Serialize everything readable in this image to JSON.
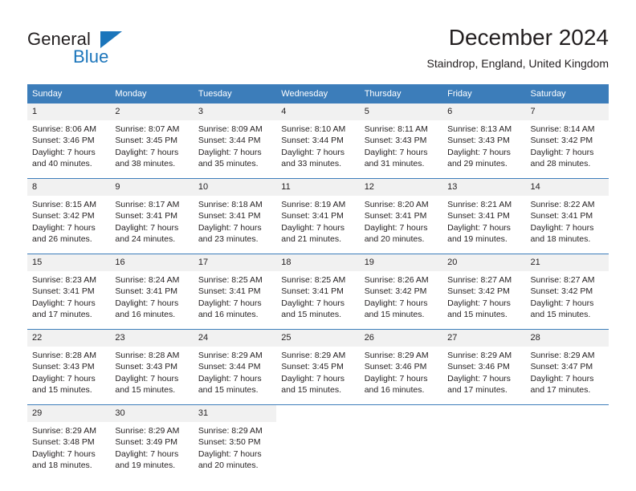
{
  "brand": {
    "name_part1": "General",
    "name_part2": "Blue",
    "triangle_color": "#1b75bb",
    "text_color": "#231f20"
  },
  "header": {
    "month_title": "December 2024",
    "location": "Staindrop, England, United Kingdom"
  },
  "colors": {
    "header_bar": "#3c7dba",
    "day_number_bg": "#f1f1f1",
    "row_divider": "#3c7dba",
    "text": "#231f20",
    "header_text": "#ffffff"
  },
  "weekdays": [
    "Sunday",
    "Monday",
    "Tuesday",
    "Wednesday",
    "Thursday",
    "Friday",
    "Saturday"
  ],
  "weeks": [
    [
      {
        "day": "1",
        "sunrise": "Sunrise: 8:06 AM",
        "sunset": "Sunset: 3:46 PM",
        "daylight_line1": "Daylight: 7 hours",
        "daylight_line2": "and 40 minutes."
      },
      {
        "day": "2",
        "sunrise": "Sunrise: 8:07 AM",
        "sunset": "Sunset: 3:45 PM",
        "daylight_line1": "Daylight: 7 hours",
        "daylight_line2": "and 38 minutes."
      },
      {
        "day": "3",
        "sunrise": "Sunrise: 8:09 AM",
        "sunset": "Sunset: 3:44 PM",
        "daylight_line1": "Daylight: 7 hours",
        "daylight_line2": "and 35 minutes."
      },
      {
        "day": "4",
        "sunrise": "Sunrise: 8:10 AM",
        "sunset": "Sunset: 3:44 PM",
        "daylight_line1": "Daylight: 7 hours",
        "daylight_line2": "and 33 minutes."
      },
      {
        "day": "5",
        "sunrise": "Sunrise: 8:11 AM",
        "sunset": "Sunset: 3:43 PM",
        "daylight_line1": "Daylight: 7 hours",
        "daylight_line2": "and 31 minutes."
      },
      {
        "day": "6",
        "sunrise": "Sunrise: 8:13 AM",
        "sunset": "Sunset: 3:43 PM",
        "daylight_line1": "Daylight: 7 hours",
        "daylight_line2": "and 29 minutes."
      },
      {
        "day": "7",
        "sunrise": "Sunrise: 8:14 AM",
        "sunset": "Sunset: 3:42 PM",
        "daylight_line1": "Daylight: 7 hours",
        "daylight_line2": "and 28 minutes."
      }
    ],
    [
      {
        "day": "8",
        "sunrise": "Sunrise: 8:15 AM",
        "sunset": "Sunset: 3:42 PM",
        "daylight_line1": "Daylight: 7 hours",
        "daylight_line2": "and 26 minutes."
      },
      {
        "day": "9",
        "sunrise": "Sunrise: 8:17 AM",
        "sunset": "Sunset: 3:41 PM",
        "daylight_line1": "Daylight: 7 hours",
        "daylight_line2": "and 24 minutes."
      },
      {
        "day": "10",
        "sunrise": "Sunrise: 8:18 AM",
        "sunset": "Sunset: 3:41 PM",
        "daylight_line1": "Daylight: 7 hours",
        "daylight_line2": "and 23 minutes."
      },
      {
        "day": "11",
        "sunrise": "Sunrise: 8:19 AM",
        "sunset": "Sunset: 3:41 PM",
        "daylight_line1": "Daylight: 7 hours",
        "daylight_line2": "and 21 minutes."
      },
      {
        "day": "12",
        "sunrise": "Sunrise: 8:20 AM",
        "sunset": "Sunset: 3:41 PM",
        "daylight_line1": "Daylight: 7 hours",
        "daylight_line2": "and 20 minutes."
      },
      {
        "day": "13",
        "sunrise": "Sunrise: 8:21 AM",
        "sunset": "Sunset: 3:41 PM",
        "daylight_line1": "Daylight: 7 hours",
        "daylight_line2": "and 19 minutes."
      },
      {
        "day": "14",
        "sunrise": "Sunrise: 8:22 AM",
        "sunset": "Sunset: 3:41 PM",
        "daylight_line1": "Daylight: 7 hours",
        "daylight_line2": "and 18 minutes."
      }
    ],
    [
      {
        "day": "15",
        "sunrise": "Sunrise: 8:23 AM",
        "sunset": "Sunset: 3:41 PM",
        "daylight_line1": "Daylight: 7 hours",
        "daylight_line2": "and 17 minutes."
      },
      {
        "day": "16",
        "sunrise": "Sunrise: 8:24 AM",
        "sunset": "Sunset: 3:41 PM",
        "daylight_line1": "Daylight: 7 hours",
        "daylight_line2": "and 16 minutes."
      },
      {
        "day": "17",
        "sunrise": "Sunrise: 8:25 AM",
        "sunset": "Sunset: 3:41 PM",
        "daylight_line1": "Daylight: 7 hours",
        "daylight_line2": "and 16 minutes."
      },
      {
        "day": "18",
        "sunrise": "Sunrise: 8:25 AM",
        "sunset": "Sunset: 3:41 PM",
        "daylight_line1": "Daylight: 7 hours",
        "daylight_line2": "and 15 minutes."
      },
      {
        "day": "19",
        "sunrise": "Sunrise: 8:26 AM",
        "sunset": "Sunset: 3:42 PM",
        "daylight_line1": "Daylight: 7 hours",
        "daylight_line2": "and 15 minutes."
      },
      {
        "day": "20",
        "sunrise": "Sunrise: 8:27 AM",
        "sunset": "Sunset: 3:42 PM",
        "daylight_line1": "Daylight: 7 hours",
        "daylight_line2": "and 15 minutes."
      },
      {
        "day": "21",
        "sunrise": "Sunrise: 8:27 AM",
        "sunset": "Sunset: 3:42 PM",
        "daylight_line1": "Daylight: 7 hours",
        "daylight_line2": "and 15 minutes."
      }
    ],
    [
      {
        "day": "22",
        "sunrise": "Sunrise: 8:28 AM",
        "sunset": "Sunset: 3:43 PM",
        "daylight_line1": "Daylight: 7 hours",
        "daylight_line2": "and 15 minutes."
      },
      {
        "day": "23",
        "sunrise": "Sunrise: 8:28 AM",
        "sunset": "Sunset: 3:43 PM",
        "daylight_line1": "Daylight: 7 hours",
        "daylight_line2": "and 15 minutes."
      },
      {
        "day": "24",
        "sunrise": "Sunrise: 8:29 AM",
        "sunset": "Sunset: 3:44 PM",
        "daylight_line1": "Daylight: 7 hours",
        "daylight_line2": "and 15 minutes."
      },
      {
        "day": "25",
        "sunrise": "Sunrise: 8:29 AM",
        "sunset": "Sunset: 3:45 PM",
        "daylight_line1": "Daylight: 7 hours",
        "daylight_line2": "and 15 minutes."
      },
      {
        "day": "26",
        "sunrise": "Sunrise: 8:29 AM",
        "sunset": "Sunset: 3:46 PM",
        "daylight_line1": "Daylight: 7 hours",
        "daylight_line2": "and 16 minutes."
      },
      {
        "day": "27",
        "sunrise": "Sunrise: 8:29 AM",
        "sunset": "Sunset: 3:46 PM",
        "daylight_line1": "Daylight: 7 hours",
        "daylight_line2": "and 17 minutes."
      },
      {
        "day": "28",
        "sunrise": "Sunrise: 8:29 AM",
        "sunset": "Sunset: 3:47 PM",
        "daylight_line1": "Daylight: 7 hours",
        "daylight_line2": "and 17 minutes."
      }
    ],
    [
      {
        "day": "29",
        "sunrise": "Sunrise: 8:29 AM",
        "sunset": "Sunset: 3:48 PM",
        "daylight_line1": "Daylight: 7 hours",
        "daylight_line2": "and 18 minutes."
      },
      {
        "day": "30",
        "sunrise": "Sunrise: 8:29 AM",
        "sunset": "Sunset: 3:49 PM",
        "daylight_line1": "Daylight: 7 hours",
        "daylight_line2": "and 19 minutes."
      },
      {
        "day": "31",
        "sunrise": "Sunrise: 8:29 AM",
        "sunset": "Sunset: 3:50 PM",
        "daylight_line1": "Daylight: 7 hours",
        "daylight_line2": "and 20 minutes."
      },
      {
        "day": "",
        "sunrise": "",
        "sunset": "",
        "daylight_line1": "",
        "daylight_line2": ""
      },
      {
        "day": "",
        "sunrise": "",
        "sunset": "",
        "daylight_line1": "",
        "daylight_line2": ""
      },
      {
        "day": "",
        "sunrise": "",
        "sunset": "",
        "daylight_line1": "",
        "daylight_line2": ""
      },
      {
        "day": "",
        "sunrise": "",
        "sunset": "",
        "daylight_line1": "",
        "daylight_line2": ""
      }
    ]
  ]
}
